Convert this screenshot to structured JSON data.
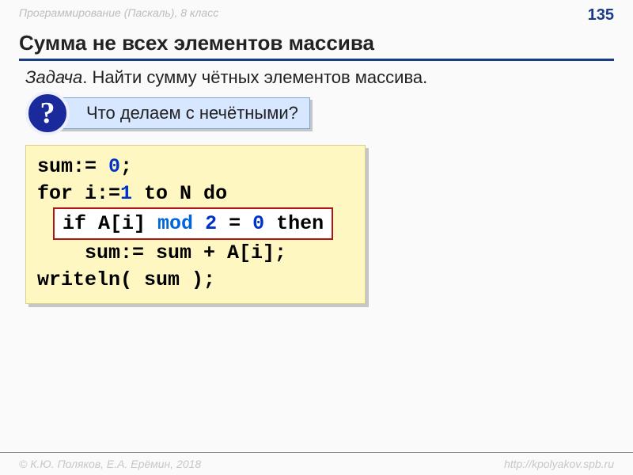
{
  "header": {
    "subject": "Программирование (Паскаль), 8 класс",
    "page_number": "135"
  },
  "title": "Сумма не всех элементов массива",
  "task": {
    "label": "Задача",
    "text": ". Найти сумму чётных элементов массива."
  },
  "question": {
    "mark": "?",
    "text": "Что делаем с нечётными?"
  },
  "code": {
    "l1_a": "sum:= ",
    "l1_num": "0",
    "l1_b": ";",
    "l2_a": "for i:=",
    "l2_num": "1",
    "l2_b": " to N do",
    "if_a": "if A[i] ",
    "if_mod": "mod",
    "if_b": " ",
    "if_two": "2",
    "if_c": " = ",
    "if_zero": "0",
    "if_d": " then",
    "l4": "    sum:= sum + A[i];",
    "l5": "writeln( sum );"
  },
  "footer": {
    "copyright": "© К.Ю. Поляков, Е.А. Ерёмин, 2018",
    "url": "http://kpolyakov.spb.ru"
  }
}
